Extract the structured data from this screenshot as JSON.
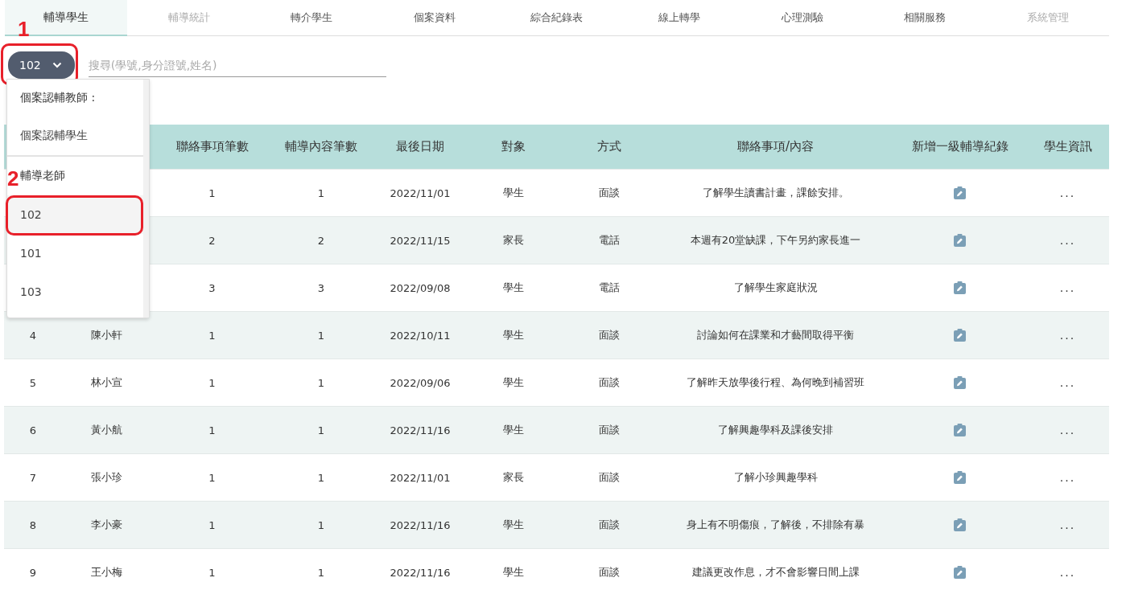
{
  "tabs": [
    {
      "label": "輔導學生",
      "selected": true,
      "disabled": false
    },
    {
      "label": "輔導統計",
      "selected": false,
      "disabled": true
    },
    {
      "label": "轉介學生",
      "selected": false,
      "disabled": false
    },
    {
      "label": "個案資料",
      "selected": false,
      "disabled": false
    },
    {
      "label": "綜合紀錄表",
      "selected": false,
      "disabled": false
    },
    {
      "label": "線上轉學",
      "selected": false,
      "disabled": false
    },
    {
      "label": "心理測驗",
      "selected": false,
      "disabled": false
    },
    {
      "label": "相關服務",
      "selected": false,
      "disabled": false
    },
    {
      "label": "系統管理",
      "selected": false,
      "disabled": true
    }
  ],
  "teacher_select": {
    "value": "102",
    "expanded": true,
    "annotation": "1"
  },
  "search": {
    "placeholder": "搜尋(學號,身分證號,姓名)"
  },
  "dropdown": {
    "items": [
      {
        "kind": "header",
        "label": "個案認輔教師 :"
      },
      {
        "kind": "option",
        "label": "個案認輔學生",
        "selected": false
      },
      {
        "kind": "divider"
      },
      {
        "kind": "header",
        "label": "輔導老師",
        "annotation": "2"
      },
      {
        "kind": "option",
        "label": "102",
        "selected": true,
        "framed": true
      },
      {
        "kind": "option",
        "label": "101",
        "selected": false
      },
      {
        "kind": "option",
        "label": "103",
        "selected": false
      }
    ]
  },
  "table": {
    "columns": [
      "",
      "",
      "聯絡事項筆數",
      "輔導內容筆數",
      "最後日期",
      "對象",
      "方式",
      "聯絡事項/內容",
      "新增一級輔導紀錄",
      "學生資訊"
    ],
    "rows": [
      {
        "no": "",
        "name": "",
        "contacts": "1",
        "sessions": "1",
        "date": "2022/11/01",
        "target": "學生",
        "method": "面談",
        "content": "了解學生讀書計畫，課餘安排。",
        "more": "..."
      },
      {
        "no": "",
        "name": "",
        "contacts": "2",
        "sessions": "2",
        "date": "2022/11/15",
        "target": "家長",
        "method": "電話",
        "content": "本週有20堂缺課，下午另約家長進一",
        "more": "..."
      },
      {
        "no": "",
        "name": "",
        "contacts": "3",
        "sessions": "3",
        "date": "2022/09/08",
        "target": "學生",
        "method": "電話",
        "content": "了解學生家庭狀況",
        "more": "..."
      },
      {
        "no": "4",
        "name": "陳小軒",
        "contacts": "1",
        "sessions": "1",
        "date": "2022/10/11",
        "target": "學生",
        "method": "面談",
        "content": "討論如何在課業和才藝間取得平衡",
        "more": "..."
      },
      {
        "no": "5",
        "name": "林小宣",
        "contacts": "1",
        "sessions": "1",
        "date": "2022/09/06",
        "target": "學生",
        "method": "面談",
        "content": "了解昨天放學後行程、為何晚到補習班",
        "more": "..."
      },
      {
        "no": "6",
        "name": "黃小航",
        "contacts": "1",
        "sessions": "1",
        "date": "2022/11/16",
        "target": "學生",
        "method": "面談",
        "content": "了解興趣學科及課後安排",
        "more": "..."
      },
      {
        "no": "7",
        "name": "張小珍",
        "contacts": "1",
        "sessions": "1",
        "date": "2022/11/01",
        "target": "家長",
        "method": "面談",
        "content": "了解小珍興趣學科",
        "more": "..."
      },
      {
        "no": "8",
        "name": "李小豪",
        "contacts": "1",
        "sessions": "1",
        "date": "2022/11/16",
        "target": "學生",
        "method": "面談",
        "content": "身上有不明傷痕，了解後，不排除有暴",
        "more": "..."
      },
      {
        "no": "9",
        "name": "王小梅",
        "contacts": "1",
        "sessions": "1",
        "date": "2022/11/16",
        "target": "學生",
        "method": "面談",
        "content": "建議更改作息，才不會影響日間上課",
        "more": "..."
      }
    ]
  }
}
